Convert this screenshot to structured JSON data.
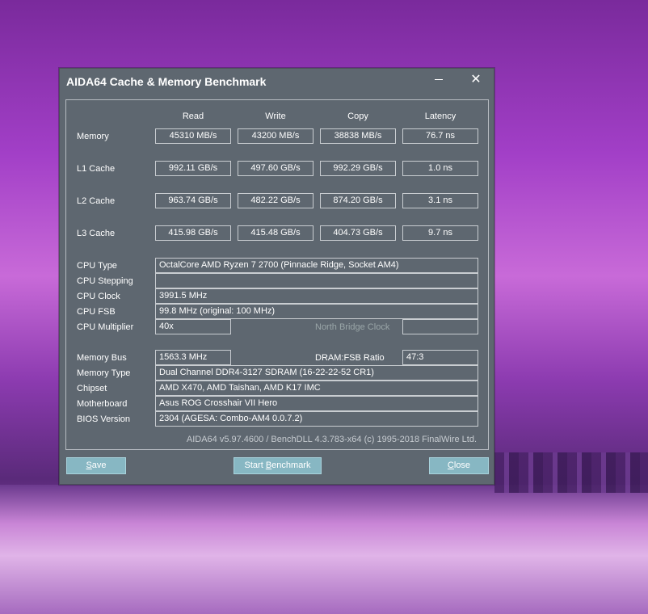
{
  "window": {
    "title": "AIDA64 Cache & Memory Benchmark",
    "close_glyph": "✕"
  },
  "columns": [
    "Read",
    "Write",
    "Copy",
    "Latency"
  ],
  "bench_rows": [
    {
      "label": "Memory",
      "read": "45310 MB/s",
      "write": "43200 MB/s",
      "copy": "38838 MB/s",
      "latency": "76.7 ns"
    },
    {
      "label": "L1 Cache",
      "read": "992.11 GB/s",
      "write": "497.60 GB/s",
      "copy": "992.29 GB/s",
      "latency": "1.0 ns"
    },
    {
      "label": "L2 Cache",
      "read": "963.74 GB/s",
      "write": "482.22 GB/s",
      "copy": "874.20 GB/s",
      "latency": "3.1 ns"
    },
    {
      "label": "L3 Cache",
      "read": "415.98 GB/s",
      "write": "415.48 GB/s",
      "copy": "404.73 GB/s",
      "latency": "9.7 ns"
    }
  ],
  "cpu": {
    "type_label": "CPU Type",
    "type_value": "OctalCore AMD Ryzen 7 2700  (Pinnacle Ridge, Socket AM4)",
    "stepping_label": "CPU Stepping",
    "stepping_value": "",
    "clock_label": "CPU Clock",
    "clock_value": "3991.5 MHz",
    "fsb_label": "CPU FSB",
    "fsb_value": "99.8 MHz  (original: 100 MHz)",
    "mult_label": "CPU Multiplier",
    "mult_value": "40x",
    "nb_clock_label": "North Bridge Clock",
    "nb_clock_value": ""
  },
  "memory": {
    "bus_label": "Memory Bus",
    "bus_value": "1563.3 MHz",
    "ratio_label": "DRAM:FSB Ratio",
    "ratio_value": "47:3",
    "type_label": "Memory Type",
    "type_value": "Dual Channel DDR4-3127 SDRAM  (16-22-22-52 CR1)",
    "chipset_label": "Chipset",
    "chipset_value": "AMD X470, AMD Taishan, AMD K17 IMC",
    "mobo_label": "Motherboard",
    "mobo_value": "Asus ROG Crosshair VII Hero",
    "bios_label": "BIOS Version",
    "bios_value": "2304  (AGESA: Combo-AM4 0.0.7.2)"
  },
  "footer": "AIDA64 v5.97.4600 / BenchDLL 4.3.783-x64  (c) 1995-2018 FinalWire Ltd.",
  "buttons": {
    "save_first": "S",
    "save_rest": "ave",
    "start_pre": "Start ",
    "start_first": "B",
    "start_rest": "enchmark",
    "close_first": "C",
    "close_rest": "lose"
  }
}
